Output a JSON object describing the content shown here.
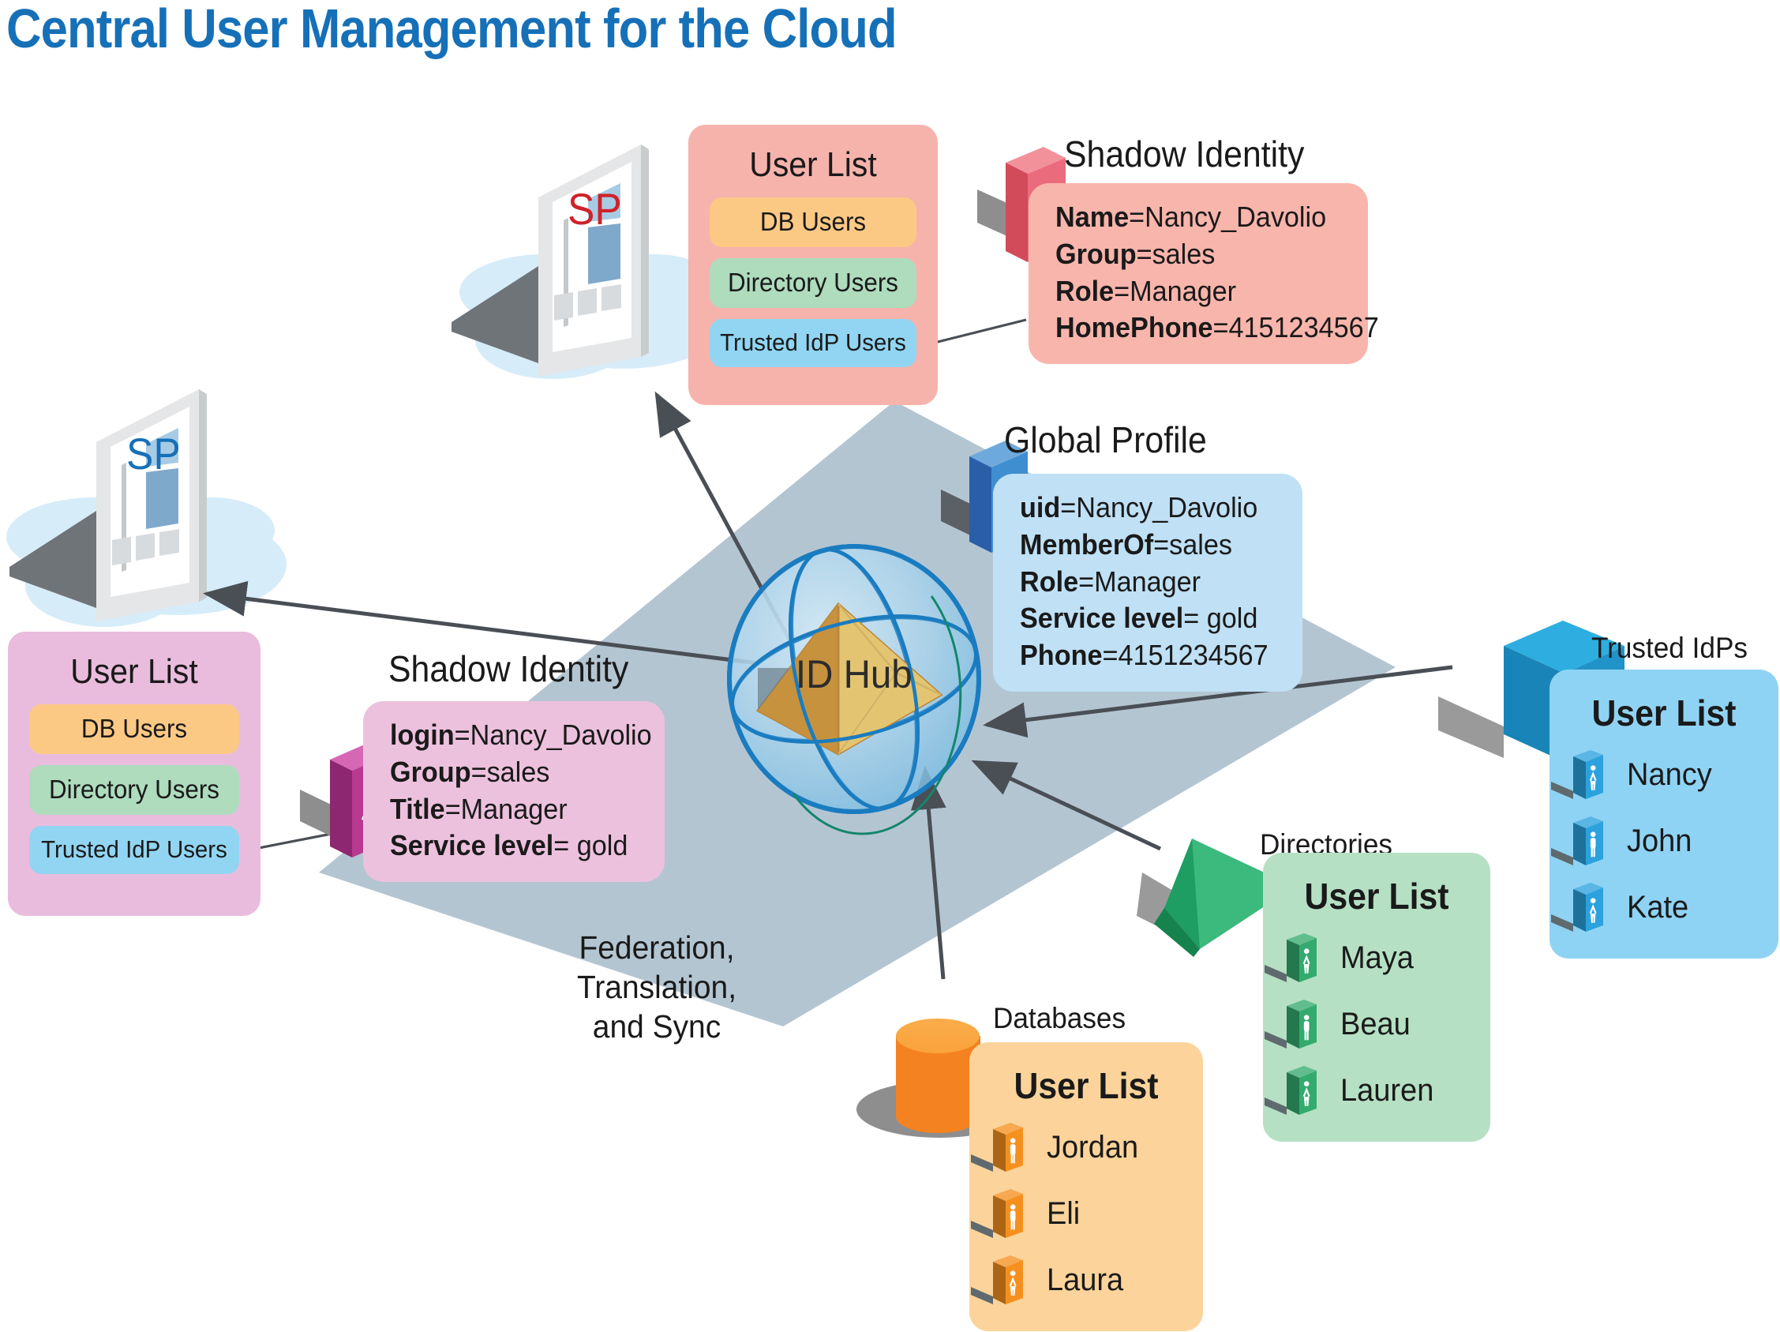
{
  "title": "Central User Management for the Cloud",
  "hub": {
    "label": "ID Hub"
  },
  "plane": {
    "label_line1": "Federation, Translation,",
    "label_line2": "and Sync"
  },
  "service_providers": [
    {
      "id": "sp-top",
      "label": "SP",
      "color": "#cf2229"
    },
    {
      "id": "sp-left",
      "label": "SP",
      "color": "#1670b8"
    }
  ],
  "sp_user_lists": [
    {
      "id": "sp-top-user-list",
      "title": "User List",
      "bg": "#f6b3ac",
      "pills": [
        {
          "label": "DB Users",
          "color": "#fcc985"
        },
        {
          "label": "Directory Users",
          "color": "#aedcbd"
        },
        {
          "label": "Trusted IdP Users",
          "color": "#91d5f2"
        }
      ]
    },
    {
      "id": "sp-left-user-list",
      "title": "User List",
      "bg": "#e9bcdd",
      "pills": [
        {
          "label": "DB Users",
          "color": "#fcc985"
        },
        {
          "label": "Directory Users",
          "color": "#aedcbd"
        },
        {
          "label": "Trusted IdP Users",
          "color": "#91d5f2"
        }
      ]
    }
  ],
  "identity_cards": [
    {
      "id": "shadow-identity-top",
      "caption": "Shadow Identity",
      "bg": "#f8b5ac",
      "icon": "female-user-cube-icon",
      "icon_color": "#e8636f",
      "rows": [
        {
          "key": "Name",
          "eq": "=",
          "value": "Nancy_Davolio"
        },
        {
          "key": "Group",
          "eq": "=",
          "value": "sales"
        },
        {
          "key": "Role",
          "eq": "=",
          "value": "Manager"
        },
        {
          "key": "HomePhone",
          "eq": "=",
          "value": "4151234567"
        }
      ]
    },
    {
      "id": "global-profile",
      "caption": "Global Profile",
      "bg": "#bfe0f5",
      "icon": "male-user-cube-icon",
      "icon_color": "#3f8ed0",
      "rows": [
        {
          "key": "uid",
          "eq": "=",
          "value": "Nancy_Davolio"
        },
        {
          "key": "MemberOf",
          "eq": "=",
          "value": "sales"
        },
        {
          "key": "Role",
          "eq": "=",
          "value": "Manager"
        },
        {
          "key": "Service level",
          "eq": "=",
          "value": " gold"
        },
        {
          "key": "Phone",
          "eq": "=",
          "value": "4151234567"
        }
      ]
    },
    {
      "id": "shadow-identity-left",
      "caption": "Shadow Identity",
      "bg": "#ecc1de",
      "icon": "female-user-cube-icon",
      "icon_color": "#b8398f",
      "rows": [
        {
          "key": "login",
          "eq": "=",
          "value": "Nancy_Davolio"
        },
        {
          "key": "Group",
          "eq": "=",
          "value": "sales"
        },
        {
          "key": "Title",
          "eq": "=",
          "value": "Manager"
        },
        {
          "key": "Service level",
          "eq": "=",
          "value": " gold"
        }
      ]
    }
  ],
  "sources": [
    {
      "id": "trusted-idps",
      "caption": "Trusted IdPs",
      "shape": "cube",
      "shape_color": "#1f9ad4",
      "bg": "#8fd3f4",
      "title": "User List",
      "icon_color": "#2ba2dd",
      "users": [
        {
          "name": "Nancy",
          "gender": "female"
        },
        {
          "name": "John",
          "gender": "male"
        },
        {
          "name": "Kate",
          "gender": "female"
        }
      ]
    },
    {
      "id": "directories",
      "caption": "Directories",
      "shape": "wedge",
      "shape_color": "#1f9e63",
      "bg": "#b6e0c3",
      "title": "User List",
      "icon_color": "#34ab6e",
      "users": [
        {
          "name": "Maya",
          "gender": "female"
        },
        {
          "name": "Beau",
          "gender": "male"
        },
        {
          "name": "Lauren",
          "gender": "female"
        }
      ]
    },
    {
      "id": "databases",
      "caption": "Databases",
      "shape": "cylinder",
      "shape_color": "#f58220",
      "bg": "#fcd49b",
      "title": "User List",
      "icon_color": "#f5901e",
      "users": [
        {
          "name": "Jordan",
          "gender": "male"
        },
        {
          "name": "Eli",
          "gender": "male"
        },
        {
          "name": "Laura",
          "gender": "female"
        }
      ]
    }
  ],
  "colors": {
    "title_blue": "#1670b8",
    "plane_slate": "#b4c5d2",
    "arrow_gray": "#4a4f55",
    "cloud_blue": "#d6ecf9",
    "sphere_blue": "#1a7cc0",
    "pyramid_orange": "#e08214",
    "pyramid_gold": "#fcc551"
  }
}
